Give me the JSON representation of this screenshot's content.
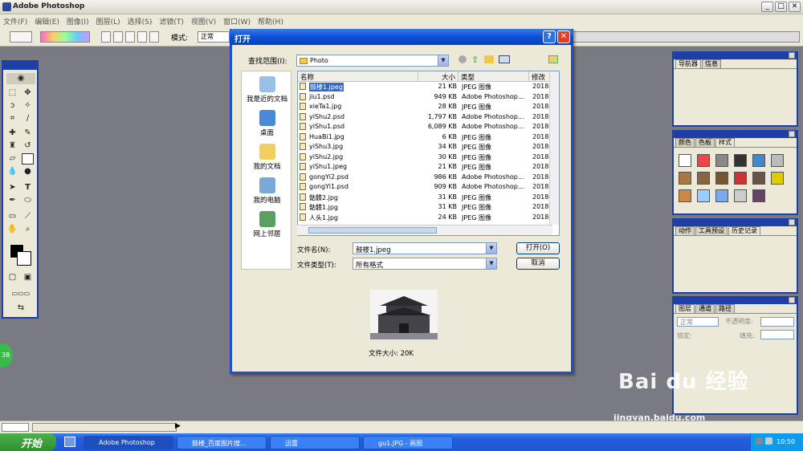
{
  "ps": {
    "title": "Adobe Photoshop",
    "menu": [
      "文件(F)",
      "编辑(E)",
      "图像(I)",
      "图层(L)",
      "选择(S)",
      "滤镜(T)",
      "视图(V)",
      "窗口(W)",
      "帮助(H)"
    ],
    "options": {
      "mode_label": "模式:",
      "mode_value": "正常"
    }
  },
  "dialog": {
    "title": "打开",
    "lookin_label": "查找范围(I):",
    "lookin_value": "Photo",
    "places": [
      {
        "label": "我是近的文档",
        "icon": "recent-docs-icon"
      },
      {
        "label": "桌面",
        "icon": "desktop-icon"
      },
      {
        "label": "我的文档",
        "icon": "my-documents-icon"
      },
      {
        "label": "我的电脑",
        "icon": "my-computer-icon"
      },
      {
        "label": "网上邻居",
        "icon": "network-icon"
      }
    ],
    "columns": {
      "name": "名称",
      "size": "大小",
      "type": "类型",
      "modified": "修改"
    },
    "files": [
      {
        "name": "鼓楼1.jpeg",
        "size": "21 KB",
        "type": "JPEG 图像",
        "mod": "2018-",
        "selected": true
      },
      {
        "name": "jiu1.psd",
        "size": "949 KB",
        "type": "Adobe Photoshop...",
        "mod": "2018-"
      },
      {
        "name": "xieTa1.jpg",
        "size": "28 KB",
        "type": "JPEG 图像",
        "mod": "2018-"
      },
      {
        "name": "yiShu2.psd",
        "size": "1,797 KB",
        "type": "Adobe Photoshop...",
        "mod": "2018-"
      },
      {
        "name": "yiShu1.psd",
        "size": "6,089 KB",
        "type": "Adobe Photoshop...",
        "mod": "2018-"
      },
      {
        "name": "HuaBi1.jpg",
        "size": "6 KB",
        "type": "JPEG 图像",
        "mod": "2018-"
      },
      {
        "name": "yiShu3.jpg",
        "size": "34 KB",
        "type": "JPEG 图像",
        "mod": "2018-"
      },
      {
        "name": "yiShu2.jpg",
        "size": "30 KB",
        "type": "JPEG 图像",
        "mod": "2018-"
      },
      {
        "name": "yiShu1.jpeg",
        "size": "21 KB",
        "type": "JPEG 图像",
        "mod": "2018-"
      },
      {
        "name": "gongYi2.psd",
        "size": "986 KB",
        "type": "Adobe Photoshop...",
        "mod": "2018-"
      },
      {
        "name": "gongYi1.psd",
        "size": "909 KB",
        "type": "Adobe Photoshop...",
        "mod": "2018-"
      },
      {
        "name": "骷髅2.jpg",
        "size": "31 KB",
        "type": "JPEG 图像",
        "mod": "2018-"
      },
      {
        "name": "骷髅1.jpg",
        "size": "31 KB",
        "type": "JPEG 图像",
        "mod": "2018-"
      },
      {
        "name": "人头1.jpg",
        "size": "24 KB",
        "type": "JPEG 图像",
        "mod": "2018-"
      }
    ],
    "filename_label": "文件名(N):",
    "filename_value": "鼓楼1.jpeg",
    "filetype_label": "文件类型(T):",
    "filetype_value": "所有格式",
    "open_button": "打开(O)",
    "cancel_button": "取消",
    "filesize_text": "文件大小: 20K"
  },
  "palettes": {
    "nav_tabs": [
      "导航器",
      "信息"
    ],
    "color_tabs": [
      "颜色",
      "色板",
      "样式"
    ],
    "history_tabs": [
      "动作",
      "工具预设",
      "历史记录"
    ],
    "layer_tabs": [
      "图层",
      "通道",
      "路径"
    ],
    "layer_mode": "正常",
    "opacity_label": "不透明度:",
    "lock_label": "锁定:",
    "fill_label": "填充:"
  },
  "taskbar": {
    "start": "开始",
    "tasks": [
      "Adobe Photoshop",
      "鼓楼_百度图片搜...",
      "迅雷",
      "gu1.JPG - 画图"
    ],
    "clock": "10:50"
  },
  "badge": "38",
  "watermark": {
    "main": "Bai du 经验",
    "sub": "jingyan.baidu.com"
  }
}
